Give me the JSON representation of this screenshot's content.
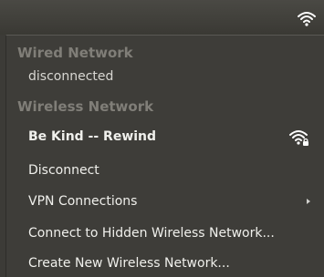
{
  "topbar": {
    "icon": "wifi-icon"
  },
  "menu": {
    "wired_header": "Wired Network",
    "wired_status": "disconnected",
    "wireless_header": "Wireless Network",
    "active_network": "Be Kind -- Rewind",
    "active_network_icon": "wifi-secure-icon",
    "items": [
      {
        "label": "Disconnect"
      },
      {
        "label": "VPN Connections",
        "submenu": true
      },
      {
        "label": "Connect to Hidden Wireless Network..."
      },
      {
        "label": "Create New Wireless Network..."
      }
    ]
  }
}
